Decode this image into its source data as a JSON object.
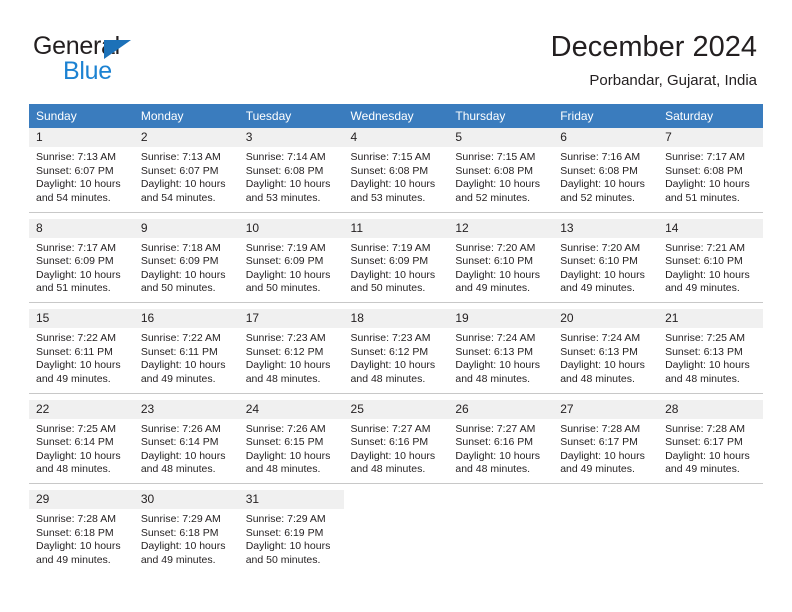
{
  "brand": {
    "name_top": "General",
    "name_bottom": "Blue",
    "accent_color": "#1c82d2",
    "triangle_color": "#1c71b8"
  },
  "header": {
    "title": "December 2024",
    "location": "Porbandar, Gujarat, India"
  },
  "theme": {
    "header_row_bg": "#3a7cbe",
    "day_number_bg": "#f0f0f0",
    "text_color": "#231f20",
    "grid_line": "#c8c8c8"
  },
  "weekday_headers": [
    "Sunday",
    "Monday",
    "Tuesday",
    "Wednesday",
    "Thursday",
    "Friday",
    "Saturday"
  ],
  "labels": {
    "sunrise_prefix": "Sunrise:",
    "sunset_prefix": "Sunset:",
    "daylight_prefix": "Daylight:"
  },
  "weeks": [
    [
      {
        "day": "1",
        "sunrise": "Sunrise: 7:13 AM",
        "sunset": "Sunset: 6:07 PM",
        "daylight_line1": "Daylight: 10 hours",
        "daylight_line2": "and 54 minutes."
      },
      {
        "day": "2",
        "sunrise": "Sunrise: 7:13 AM",
        "sunset": "Sunset: 6:07 PM",
        "daylight_line1": "Daylight: 10 hours",
        "daylight_line2": "and 54 minutes."
      },
      {
        "day": "3",
        "sunrise": "Sunrise: 7:14 AM",
        "sunset": "Sunset: 6:08 PM",
        "daylight_line1": "Daylight: 10 hours",
        "daylight_line2": "and 53 minutes."
      },
      {
        "day": "4",
        "sunrise": "Sunrise: 7:15 AM",
        "sunset": "Sunset: 6:08 PM",
        "daylight_line1": "Daylight: 10 hours",
        "daylight_line2": "and 53 minutes."
      },
      {
        "day": "5",
        "sunrise": "Sunrise: 7:15 AM",
        "sunset": "Sunset: 6:08 PM",
        "daylight_line1": "Daylight: 10 hours",
        "daylight_line2": "and 52 minutes."
      },
      {
        "day": "6",
        "sunrise": "Sunrise: 7:16 AM",
        "sunset": "Sunset: 6:08 PM",
        "daylight_line1": "Daylight: 10 hours",
        "daylight_line2": "and 52 minutes."
      },
      {
        "day": "7",
        "sunrise": "Sunrise: 7:17 AM",
        "sunset": "Sunset: 6:08 PM",
        "daylight_line1": "Daylight: 10 hours",
        "daylight_line2": "and 51 minutes."
      }
    ],
    [
      {
        "day": "8",
        "sunrise": "Sunrise: 7:17 AM",
        "sunset": "Sunset: 6:09 PM",
        "daylight_line1": "Daylight: 10 hours",
        "daylight_line2": "and 51 minutes."
      },
      {
        "day": "9",
        "sunrise": "Sunrise: 7:18 AM",
        "sunset": "Sunset: 6:09 PM",
        "daylight_line1": "Daylight: 10 hours",
        "daylight_line2": "and 50 minutes."
      },
      {
        "day": "10",
        "sunrise": "Sunrise: 7:19 AM",
        "sunset": "Sunset: 6:09 PM",
        "daylight_line1": "Daylight: 10 hours",
        "daylight_line2": "and 50 minutes."
      },
      {
        "day": "11",
        "sunrise": "Sunrise: 7:19 AM",
        "sunset": "Sunset: 6:09 PM",
        "daylight_line1": "Daylight: 10 hours",
        "daylight_line2": "and 50 minutes."
      },
      {
        "day": "12",
        "sunrise": "Sunrise: 7:20 AM",
        "sunset": "Sunset: 6:10 PM",
        "daylight_line1": "Daylight: 10 hours",
        "daylight_line2": "and 49 minutes."
      },
      {
        "day": "13",
        "sunrise": "Sunrise: 7:20 AM",
        "sunset": "Sunset: 6:10 PM",
        "daylight_line1": "Daylight: 10 hours",
        "daylight_line2": "and 49 minutes."
      },
      {
        "day": "14",
        "sunrise": "Sunrise: 7:21 AM",
        "sunset": "Sunset: 6:10 PM",
        "daylight_line1": "Daylight: 10 hours",
        "daylight_line2": "and 49 minutes."
      }
    ],
    [
      {
        "day": "15",
        "sunrise": "Sunrise: 7:22 AM",
        "sunset": "Sunset: 6:11 PM",
        "daylight_line1": "Daylight: 10 hours",
        "daylight_line2": "and 49 minutes."
      },
      {
        "day": "16",
        "sunrise": "Sunrise: 7:22 AM",
        "sunset": "Sunset: 6:11 PM",
        "daylight_line1": "Daylight: 10 hours",
        "daylight_line2": "and 49 minutes."
      },
      {
        "day": "17",
        "sunrise": "Sunrise: 7:23 AM",
        "sunset": "Sunset: 6:12 PM",
        "daylight_line1": "Daylight: 10 hours",
        "daylight_line2": "and 48 minutes."
      },
      {
        "day": "18",
        "sunrise": "Sunrise: 7:23 AM",
        "sunset": "Sunset: 6:12 PM",
        "daylight_line1": "Daylight: 10 hours",
        "daylight_line2": "and 48 minutes."
      },
      {
        "day": "19",
        "sunrise": "Sunrise: 7:24 AM",
        "sunset": "Sunset: 6:13 PM",
        "daylight_line1": "Daylight: 10 hours",
        "daylight_line2": "and 48 minutes."
      },
      {
        "day": "20",
        "sunrise": "Sunrise: 7:24 AM",
        "sunset": "Sunset: 6:13 PM",
        "daylight_line1": "Daylight: 10 hours",
        "daylight_line2": "and 48 minutes."
      },
      {
        "day": "21",
        "sunrise": "Sunrise: 7:25 AM",
        "sunset": "Sunset: 6:13 PM",
        "daylight_line1": "Daylight: 10 hours",
        "daylight_line2": "and 48 minutes."
      }
    ],
    [
      {
        "day": "22",
        "sunrise": "Sunrise: 7:25 AM",
        "sunset": "Sunset: 6:14 PM",
        "daylight_line1": "Daylight: 10 hours",
        "daylight_line2": "and 48 minutes."
      },
      {
        "day": "23",
        "sunrise": "Sunrise: 7:26 AM",
        "sunset": "Sunset: 6:14 PM",
        "daylight_line1": "Daylight: 10 hours",
        "daylight_line2": "and 48 minutes."
      },
      {
        "day": "24",
        "sunrise": "Sunrise: 7:26 AM",
        "sunset": "Sunset: 6:15 PM",
        "daylight_line1": "Daylight: 10 hours",
        "daylight_line2": "and 48 minutes."
      },
      {
        "day": "25",
        "sunrise": "Sunrise: 7:27 AM",
        "sunset": "Sunset: 6:16 PM",
        "daylight_line1": "Daylight: 10 hours",
        "daylight_line2": "and 48 minutes."
      },
      {
        "day": "26",
        "sunrise": "Sunrise: 7:27 AM",
        "sunset": "Sunset: 6:16 PM",
        "daylight_line1": "Daylight: 10 hours",
        "daylight_line2": "and 48 minutes."
      },
      {
        "day": "27",
        "sunrise": "Sunrise: 7:28 AM",
        "sunset": "Sunset: 6:17 PM",
        "daylight_line1": "Daylight: 10 hours",
        "daylight_line2": "and 49 minutes."
      },
      {
        "day": "28",
        "sunrise": "Sunrise: 7:28 AM",
        "sunset": "Sunset: 6:17 PM",
        "daylight_line1": "Daylight: 10 hours",
        "daylight_line2": "and 49 minutes."
      }
    ],
    [
      {
        "day": "29",
        "sunrise": "Sunrise: 7:28 AM",
        "sunset": "Sunset: 6:18 PM",
        "daylight_line1": "Daylight: 10 hours",
        "daylight_line2": "and 49 minutes."
      },
      {
        "day": "30",
        "sunrise": "Sunrise: 7:29 AM",
        "sunset": "Sunset: 6:18 PM",
        "daylight_line1": "Daylight: 10 hours",
        "daylight_line2": "and 49 minutes."
      },
      {
        "day": "31",
        "sunrise": "Sunrise: 7:29 AM",
        "sunset": "Sunset: 6:19 PM",
        "daylight_line1": "Daylight: 10 hours",
        "daylight_line2": "and 50 minutes."
      },
      {
        "day": "",
        "sunrise": "",
        "sunset": "",
        "daylight_line1": "",
        "daylight_line2": ""
      },
      {
        "day": "",
        "sunrise": "",
        "sunset": "",
        "daylight_line1": "",
        "daylight_line2": ""
      },
      {
        "day": "",
        "sunrise": "",
        "sunset": "",
        "daylight_line1": "",
        "daylight_line2": ""
      },
      {
        "day": "",
        "sunrise": "",
        "sunset": "",
        "daylight_line1": "",
        "daylight_line2": ""
      }
    ]
  ]
}
